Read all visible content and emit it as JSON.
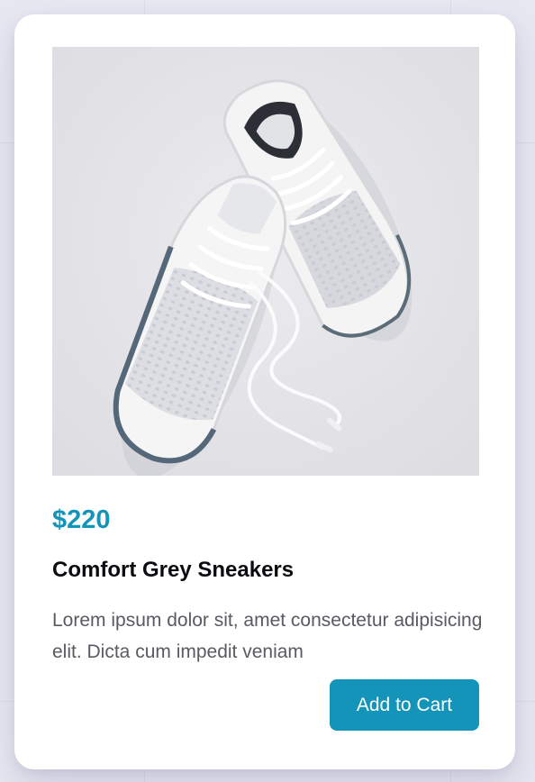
{
  "product": {
    "image_alt": "White mesh running sneakers with untied laces on a light grey background",
    "price": "$220",
    "title": "Comfort Grey Sneakers",
    "description": "Lorem ipsum dolor sit, amet consectetur adipisicing elit. Dicta cum impedit veniam",
    "cta_label": "Add to Cart"
  },
  "colors": {
    "accent": "#1494b8",
    "page_background": "#e8e8f2",
    "card_background": "#ffffff",
    "title_text": "#0c0c10",
    "body_text": "#5a5a62"
  }
}
